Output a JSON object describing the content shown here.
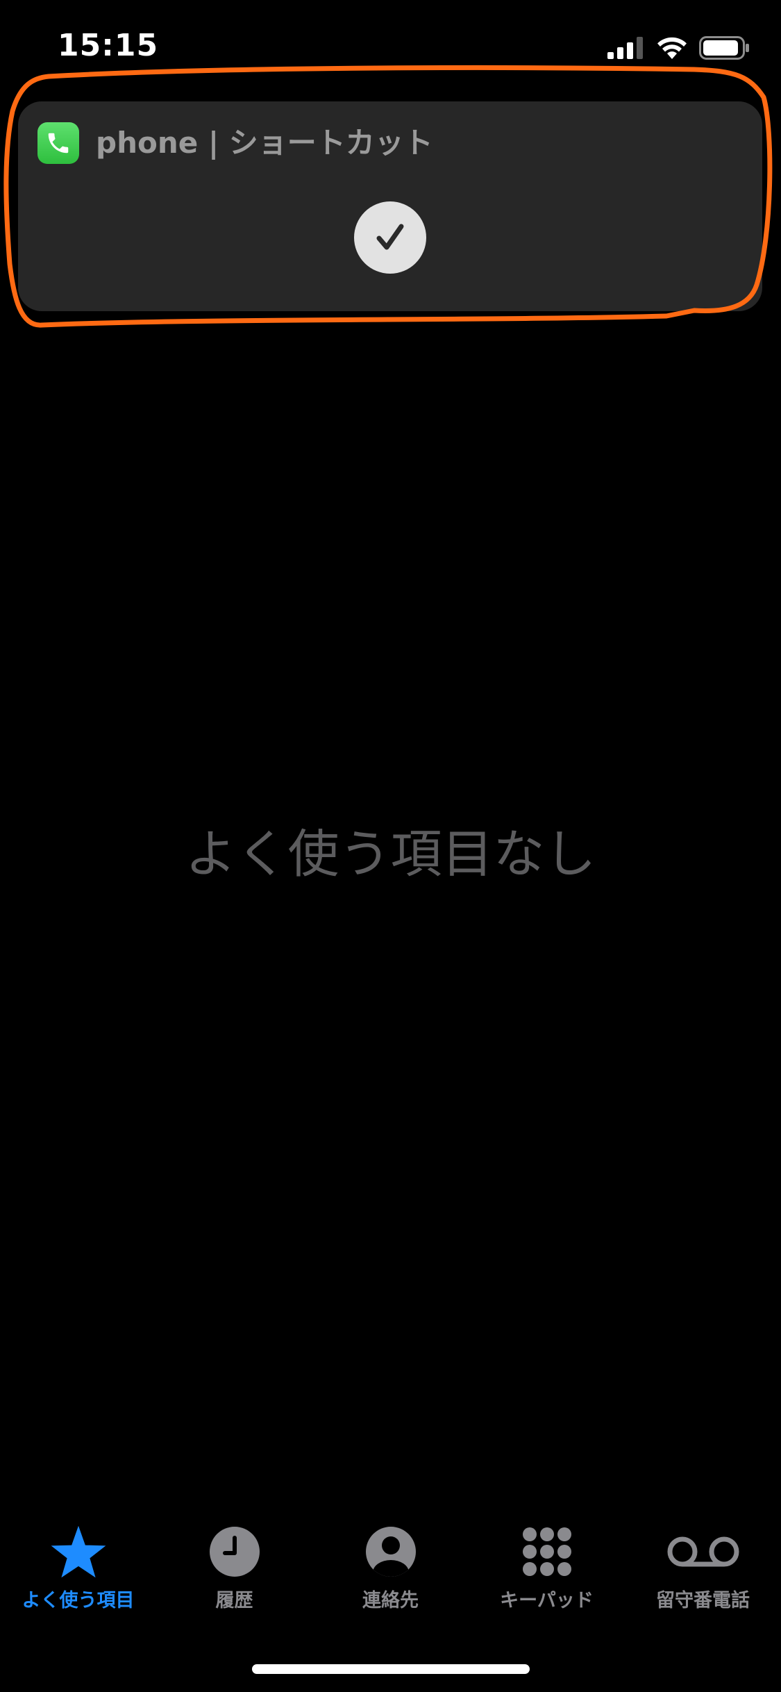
{
  "status_bar": {
    "time": "15:15",
    "icons": [
      "cellular-signal-icon",
      "wifi-icon",
      "battery-icon"
    ]
  },
  "banner": {
    "app_icon": "phone-icon",
    "title": "phone | ショートカット",
    "check_icon": "checkmark-icon"
  },
  "annotation": {
    "color": "#ff6a13"
  },
  "main": {
    "empty_message": "よく使う項目なし"
  },
  "tab_bar": {
    "tabs": [
      {
        "label": "よく使う項目",
        "icon": "star-icon",
        "active": true
      },
      {
        "label": "履歴",
        "icon": "clock-icon",
        "active": false
      },
      {
        "label": "連絡先",
        "icon": "person-circle-icon",
        "active": false
      },
      {
        "label": "キーパッド",
        "icon": "keypad-icon",
        "active": false
      },
      {
        "label": "留守番電話",
        "icon": "voicemail-icon",
        "active": false
      }
    ],
    "active_color": "#1e8cff",
    "inactive_color": "#8a8a8e"
  }
}
